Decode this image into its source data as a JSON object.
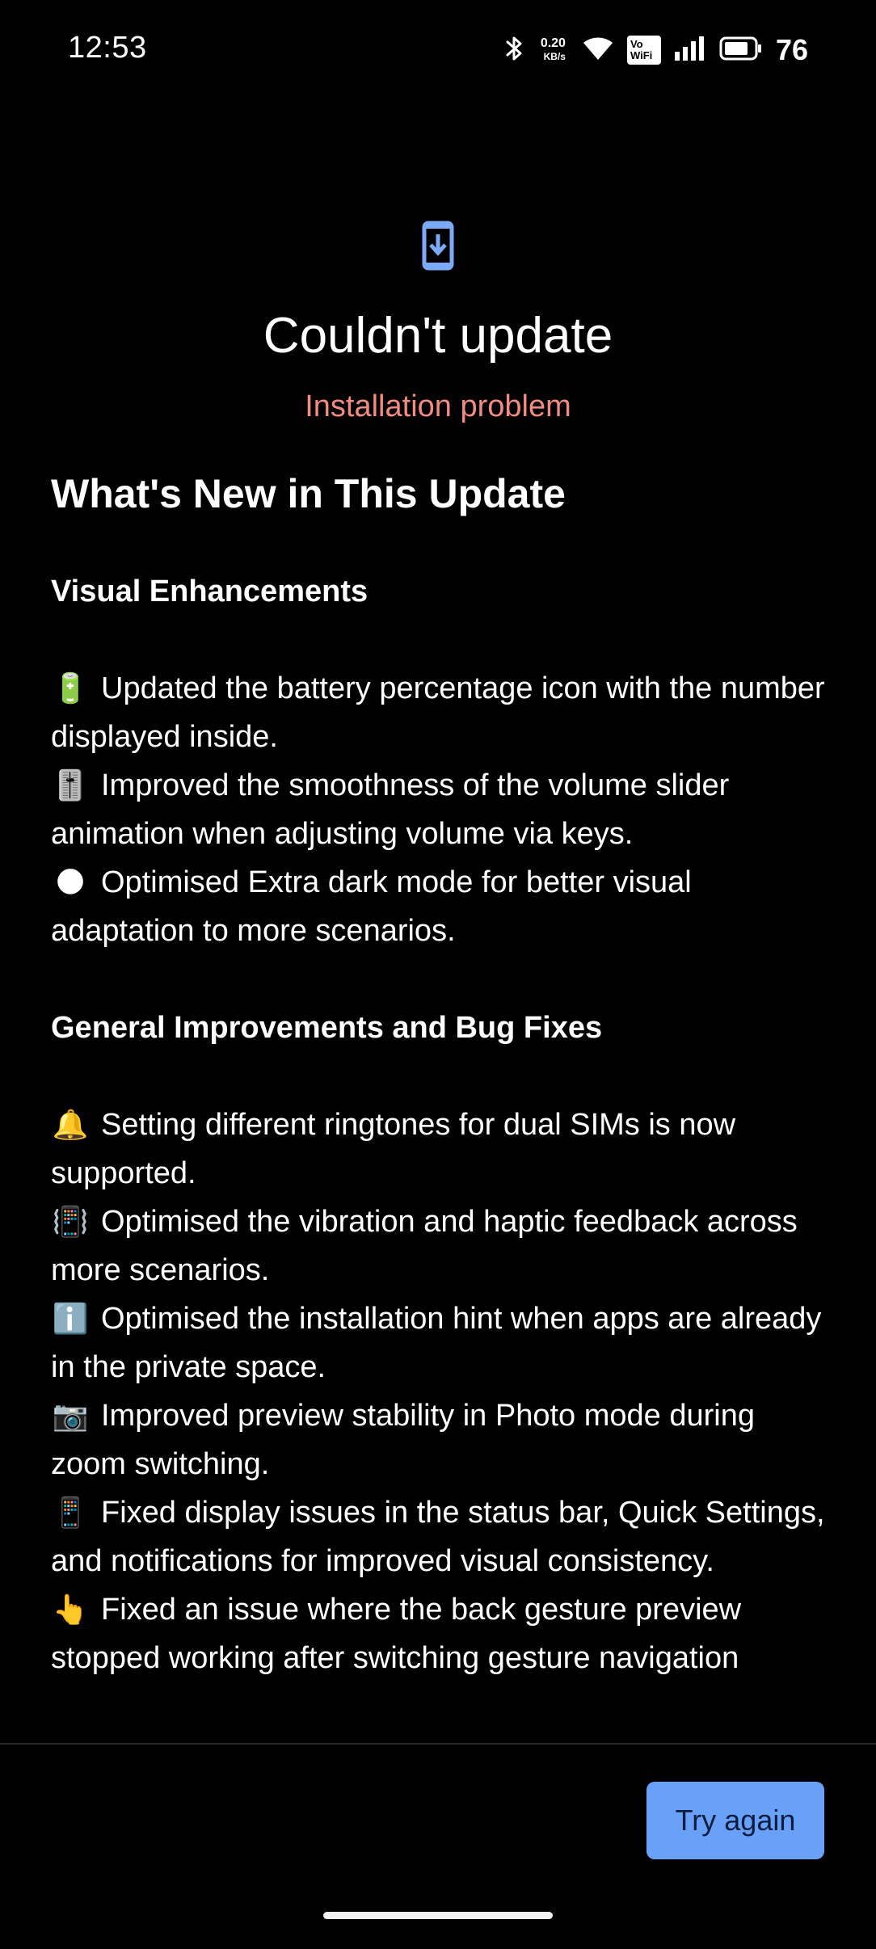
{
  "status_bar": {
    "time": "12:53",
    "net_speed_value": "0.20",
    "net_speed_unit": "KB/s",
    "vowifi_top": "Vo",
    "vowifi_bottom": "WiFi",
    "battery_percent": "76",
    "icons": [
      "bluetooth-icon",
      "wifi-icon",
      "vowifi-icon",
      "signal-icon",
      "battery-icon"
    ]
  },
  "header": {
    "icon": "phone-download-icon",
    "title": "Couldn't update",
    "subtitle": "Installation problem"
  },
  "content": {
    "heading": "What's New in This Update",
    "sections": [
      {
        "title": "Visual Enhancements",
        "items": [
          {
            "emoji": "🔋",
            "text": "Updated the battery percentage icon with the number displayed inside."
          },
          {
            "emoji": "🎚️",
            "text": "Improved the smoothness of the volume slider animation when adjusting volume via keys."
          },
          {
            "emoji": "🌑",
            "text": "Optimised Extra dark mode for better visual adaptation to more scenarios."
          }
        ]
      },
      {
        "title": "General Improvements and Bug Fixes",
        "items": [
          {
            "emoji": "🔔",
            "text": "Setting different ringtones for dual SIMs is now supported."
          },
          {
            "emoji": "📳",
            "text": "Optimised the vibration and haptic feedback across more scenarios."
          },
          {
            "emoji": "ℹ️",
            "text": "Optimised the installation hint when apps are already in the private space."
          },
          {
            "emoji": "📷",
            "text": "Improved preview stability in Photo mode during zoom switching."
          },
          {
            "emoji": "📱",
            "text": "Fixed display issues in the status bar, Quick Settings, and notifications for improved visual consistency."
          },
          {
            "emoji": "👆",
            "text": "Fixed an issue where the back gesture preview stopped working after switching gesture navigation"
          }
        ]
      }
    ]
  },
  "footer": {
    "try_again_label": "Try again"
  },
  "colors": {
    "background": "#000000",
    "accent": "#6aa1f8",
    "error": "#f28b82",
    "icon_blue": "#7baaf7"
  }
}
